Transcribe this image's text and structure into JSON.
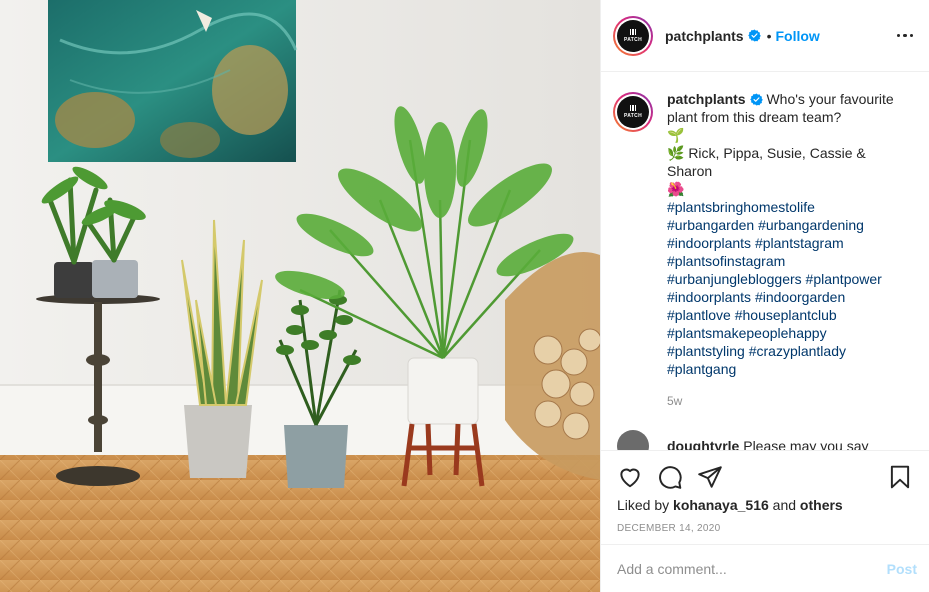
{
  "post": {
    "username": "patchplants",
    "avatar_text": "PATCH",
    "follow_label": "Follow",
    "separator": "•",
    "photo_alt": "Room with houseplants on a herringbone wooden floor",
    "caption": {
      "text_line1": "Who's your favourite plant from this dream team?",
      "emoji_seedling": "🌱",
      "names": "🌿 Rick, Pippa, Susie, Cassie & Sharon",
      "emoji_flower": "🌺",
      "hashtag_lines": [
        "#plantsbringhomestolife",
        "#urbangarden #urbangardening",
        "#indoorplants #plantstagram",
        "#plantsofinstagram",
        "#urbanjunglebloggers #plantpower",
        "#indoorplants #indoorgarden",
        "#plantlove #houseplantclub",
        "#plantsmakepeoplehappy",
        "#plantstyling #crazyplantlady",
        "#plantgang"
      ],
      "age": "5w"
    },
    "next_comment": {
      "username": "doughtyrle",
      "text": "Please may you say"
    },
    "liked_by_prefix": "Liked by",
    "liked_by_user": "kohanaya_516",
    "liked_by_and": "and",
    "liked_by_others": "others",
    "date": "DECEMBER 14, 2020",
    "comment_placeholder": "Add a comment...",
    "post_label": "Post"
  },
  "icons": {
    "like": "heart-icon",
    "comment": "comment-bubble-icon",
    "share": "paper-plane-icon",
    "save": "bookmark-icon",
    "verified": "verified-badge-icon",
    "more": "more-options-icon"
  },
  "colors": {
    "link_blue": "#0095f6",
    "hashtag": "#00376b",
    "muted": "#8e8e8e",
    "post_disabled": "#b2dffc"
  }
}
